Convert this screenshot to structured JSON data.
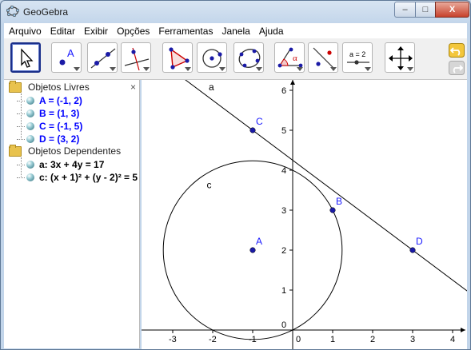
{
  "window": {
    "title": "GeoGebra",
    "minimize": "–",
    "maximize": "□",
    "close": "X"
  },
  "menu": [
    "Arquivo",
    "Editar",
    "Exibir",
    "Opções",
    "Ferramentas",
    "Janela",
    "Ajuda"
  ],
  "toolbar": {
    "tools": [
      "move",
      "new-point",
      "line-through-two-points",
      "perpendicular-line",
      "polygon",
      "circle-center-point",
      "conic-through-points",
      "angle",
      "reflect-about-line",
      "slider",
      "move-graphics-view"
    ],
    "slider_label": "a = 2",
    "point_label": "A",
    "angle_label": "α"
  },
  "algebra": {
    "free_title": "Objetos Livres",
    "free_objects": [
      "A = (-1, 2)",
      "B = (1, 3)",
      "C = (-1, 5)",
      "D = (3, 2)"
    ],
    "dependent_title": "Objetos Dependentes",
    "dependent_objects": [
      "a: 3x + 4y = 17",
      "c: (x + 1)² + (y - 2)² = 5"
    ],
    "close": "×"
  },
  "graphics": {
    "x_ticks": [
      "-3",
      "-2",
      "-1",
      "0",
      "1",
      "2",
      "3",
      "4"
    ],
    "y_ticks": [
      "6",
      "5",
      "4",
      "3",
      "2",
      "1",
      "0"
    ],
    "line_label": "a",
    "circle_label": "c",
    "points": [
      {
        "name": "A",
        "x": -1,
        "y": 2
      },
      {
        "name": "B",
        "x": 1,
        "y": 3
      },
      {
        "name": "C",
        "x": -1,
        "y": 5
      },
      {
        "name": "D",
        "x": 3,
        "y": 2
      }
    ],
    "point_color": "#1a1aa6",
    "label_color": "#1a1aff"
  }
}
